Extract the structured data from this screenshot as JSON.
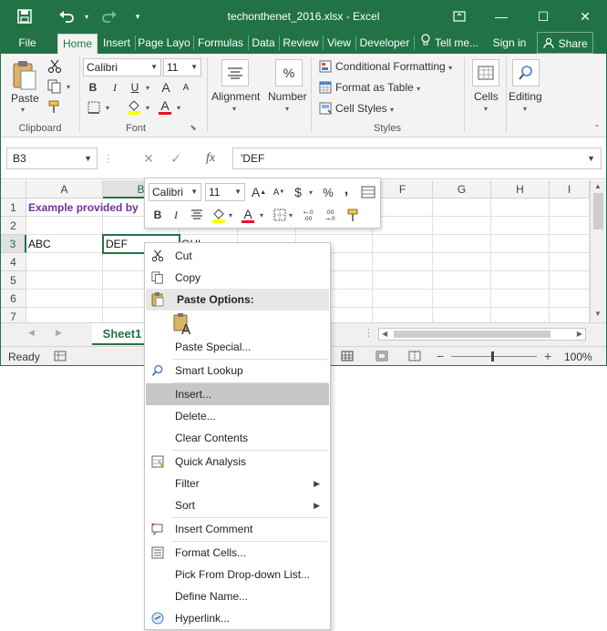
{
  "window": {
    "title": "techonthenet_2016.xlsx - Excel",
    "min_glyph": "—",
    "max_glyph": "☐",
    "close_glyph": "✕"
  },
  "tabs": {
    "file": "File",
    "home": "Home",
    "insert": "Insert",
    "page_layout": "Page Layo",
    "formulas": "Formulas",
    "data": "Data",
    "review": "Review",
    "view": "View",
    "developer": "Developer",
    "tell_me": "Tell me...",
    "sign_in": "Sign in",
    "share": "Share"
  },
  "ribbon": {
    "clipboard": {
      "paste": "Paste",
      "group": "Clipboard"
    },
    "font": {
      "name": "Calibri",
      "size": "11",
      "bold": "B",
      "italic": "I",
      "underline": "U",
      "grow": "A",
      "shrink": "A",
      "font_color_glyph": "A",
      "group": "Font"
    },
    "alignment": {
      "label": "Alignment"
    },
    "number": {
      "label": "Number",
      "glyph": "%"
    },
    "styles": {
      "conditional": "Conditional Formatting",
      "table": "Format as Table",
      "cell_styles": "Cell Styles",
      "group": "Styles"
    },
    "cells": {
      "label": "Cells"
    },
    "editing": {
      "label": "Editing"
    }
  },
  "formula_bar": {
    "name_box": "B3",
    "fx": "fx",
    "value": "'DEF"
  },
  "grid": {
    "columns": [
      "A",
      "B",
      "C",
      "D",
      "E",
      "F",
      "G",
      "H",
      "I"
    ],
    "rows": [
      "1",
      "2",
      "3",
      "4",
      "5",
      "6",
      "7"
    ],
    "cells": {
      "A1": "Example provided by",
      "A3": "ABC",
      "B3": "DEF",
      "C3": "GHI"
    }
  },
  "sheets": {
    "active": "Sheet1"
  },
  "status": {
    "ready": "Ready",
    "zoom": "100%"
  },
  "mini_toolbar": {
    "font": "Calibri",
    "size": "11",
    "bold": "B",
    "italic": "I",
    "percent": "%",
    "comma": ",",
    "dollar": "$"
  },
  "context_menu": {
    "cut": "Cut",
    "copy": "Copy",
    "paste_options": "Paste Options:",
    "paste_special": "Paste Special...",
    "smart_lookup": "Smart Lookup",
    "insert": "Insert...",
    "delete": "Delete...",
    "clear_contents": "Clear Contents",
    "quick_analysis": "Quick Analysis",
    "filter": "Filter",
    "sort": "Sort",
    "insert_comment": "Insert Comment",
    "format_cells": "Format Cells...",
    "pick_list": "Pick From Drop-down List...",
    "define_name": "Define Name...",
    "hyperlink": "Hyperlink..."
  },
  "colors": {
    "excel_green": "#217346",
    "example_purple": "#7030a0",
    "font_red": "#e81123",
    "highlight_yellow": "#ffff00"
  },
  "icons": {
    "save": "save-icon",
    "undo": "undo-icon",
    "redo": "redo-icon",
    "cut": "scissors-icon",
    "copy": "copy-icon",
    "paste": "clipboard-icon",
    "search": "magnifier-icon",
    "lightbulb": "lightbulb-icon",
    "share": "person-icon"
  }
}
